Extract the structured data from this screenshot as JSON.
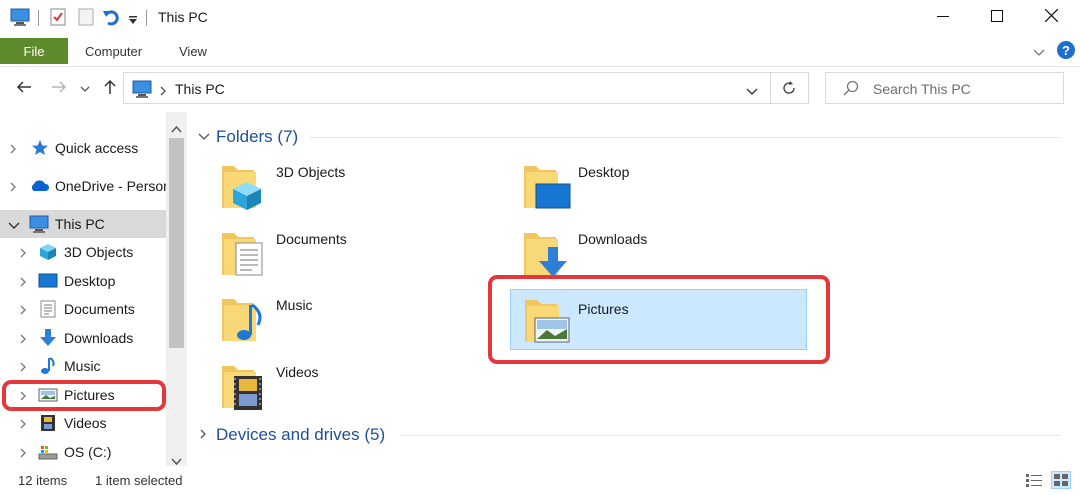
{
  "window": {
    "title": "This PC",
    "controls": {
      "minimize_icon": "minimize-icon",
      "maximize_icon": "maximize-icon",
      "close_icon": "close-icon"
    }
  },
  "ribbon": {
    "tabs": [
      {
        "label": "File",
        "active": true
      },
      {
        "label": "Computer"
      },
      {
        "label": "View"
      }
    ]
  },
  "address": {
    "path_item": "This PC",
    "search_placeholder": "Search This PC"
  },
  "navigation_pane": {
    "items": [
      {
        "label": "Quick access",
        "icon": "star-icon",
        "level": 0
      },
      {
        "label": "OneDrive - Personal",
        "icon": "cloud-icon",
        "level": 0
      },
      {
        "label": "This PC",
        "icon": "computer-icon",
        "level": 0,
        "expanded": true,
        "selected": true
      },
      {
        "label": "3D Objects",
        "icon": "cube-icon",
        "level": 1
      },
      {
        "label": "Desktop",
        "icon": "desktop-icon",
        "level": 1
      },
      {
        "label": "Documents",
        "icon": "document-icon",
        "level": 1
      },
      {
        "label": "Downloads",
        "icon": "download-arrow-icon",
        "level": 1
      },
      {
        "label": "Music",
        "icon": "music-note-icon",
        "level": 1
      },
      {
        "label": "Pictures",
        "icon": "picture-icon",
        "level": 1,
        "highlighted": true
      },
      {
        "label": "Videos",
        "icon": "film-icon",
        "level": 1
      },
      {
        "label": "OS (C:)",
        "icon": "drive-icon",
        "level": 1
      }
    ]
  },
  "content": {
    "folders_header": "Folders (7)",
    "drives_header": "Devices and drives (5)",
    "folders": [
      {
        "label": "3D Objects",
        "overlay": "cube-icon"
      },
      {
        "label": "Desktop",
        "overlay": "desktop-icon"
      },
      {
        "label": "Documents",
        "overlay": "document-icon"
      },
      {
        "label": "Downloads",
        "overlay": "download-arrow-icon"
      },
      {
        "label": "Music",
        "overlay": "music-note-icon"
      },
      {
        "label": "Pictures",
        "overlay": "picture-icon",
        "selected": true
      },
      {
        "label": "Videos",
        "overlay": "film-icon"
      }
    ]
  },
  "status": {
    "items_count": "12 items",
    "selection": "1 item selected"
  },
  "colors": {
    "file_tab": "#5f8a2c",
    "group_header": "#1e4f9a",
    "selection_fill": "#cce8ff",
    "highlight_outline": "#e5363c"
  }
}
